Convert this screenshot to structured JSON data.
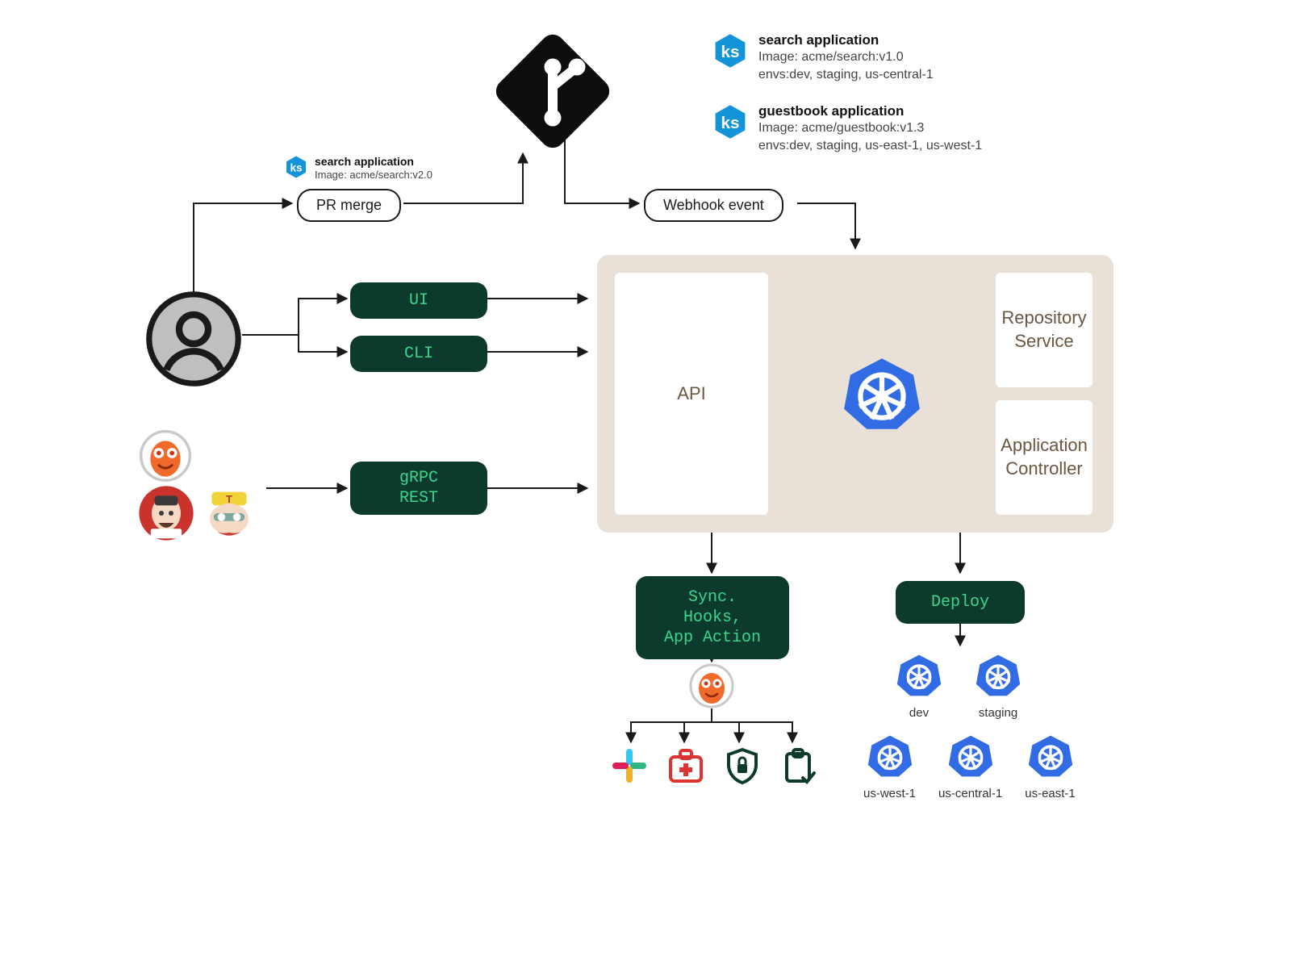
{
  "apps": {
    "update": {
      "title": "search application",
      "image": "Image: acme/search:v2.0"
    },
    "search": {
      "title": "search application",
      "image": "Image: acme/search:v1.0",
      "envs": "envs:dev, staging, us-central-1"
    },
    "guestbook": {
      "title": "guestbook application",
      "image": "Image: acme/guestbook:v1.3",
      "envs": "envs:dev, staging, us-east-1, us-west-1"
    }
  },
  "labels": {
    "pr_merge": "PR merge",
    "webhook": "Webhook event",
    "ui": "UI",
    "cli": "CLI",
    "grpc": "gRPC\nREST",
    "sync": "Sync. Hooks,\nApp Action",
    "deploy": "Deploy"
  },
  "argo": {
    "api": "API",
    "repo": "Repository\nService",
    "controller": "Application\nController"
  },
  "clusters": [
    "dev",
    "staging",
    "us-west-1",
    "us-central-1",
    "us-east-1"
  ]
}
